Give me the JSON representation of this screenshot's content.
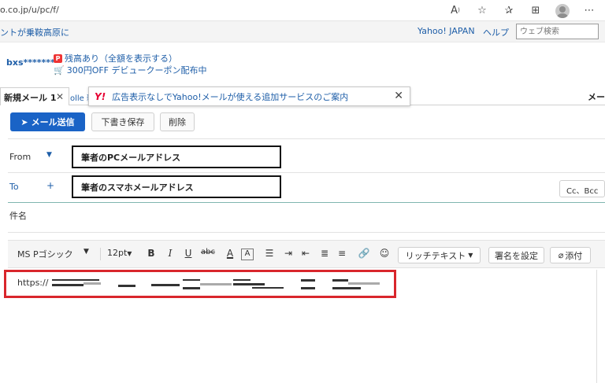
{
  "browser": {
    "url": "o.co.jp/u/pc/f/",
    "icons": [
      "read-aloud-icon",
      "favorite-add-icon",
      "favorites-icon",
      "collections-icon",
      "profile-icon",
      "more-icon"
    ]
  },
  "yahoo_header": {
    "left_message": "ントが乗鞍高原に",
    "yahoo_japan": "Yahoo! JAPAN",
    "help": "ヘルプ",
    "search_placeholder": "ウェブ検索"
  },
  "account": {
    "user": "bxs********",
    "notice_balance": "残高あり（全額を表示する）",
    "notice_coupon": "300円OFF デビュークーポン配布中"
  },
  "tabs": {
    "new_mail": "新規メール 1",
    "other": "olle 新",
    "right": "メー"
  },
  "ad": {
    "logo": "Y!",
    "text": "広告表示なしでYahoo!メールが使える追加サービスのご案内"
  },
  "actions": {
    "send": "メール送信",
    "save_draft": "下書き保存",
    "delete": "削除"
  },
  "fields": {
    "from_label": "From",
    "from_value": "筆者のPCメールアドレス",
    "to_label": "To",
    "to_value": "筆者のスマホメールアドレス",
    "cc_bcc": "Cc、Bcc",
    "subject_label": "件名"
  },
  "editor": {
    "font": "MS Pゴシック",
    "size": "12pt",
    "rich_text": "リッチテキスト",
    "signature": "署名を設定",
    "attach": "添付"
  },
  "body": {
    "url_prefix": "https://"
  }
}
